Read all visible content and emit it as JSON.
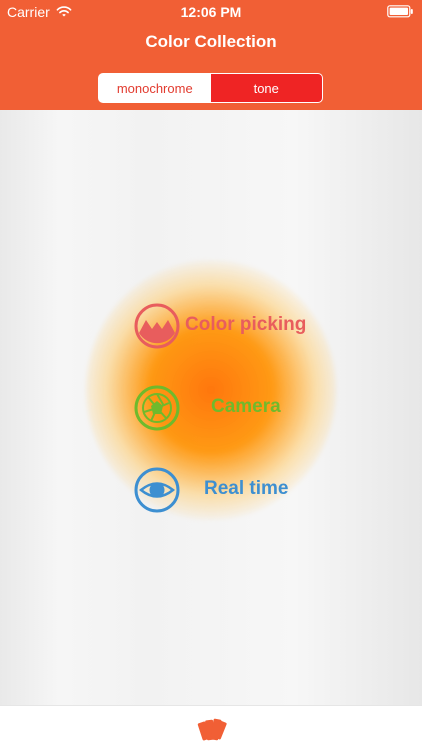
{
  "status_bar": {
    "carrier": "Carrier",
    "time": "12:06 PM",
    "battery_icon": "battery-icon",
    "wifi_icon": "wifi-icon"
  },
  "header": {
    "title": "Color Collection",
    "tabs": [
      {
        "label": "monochrome"
      },
      {
        "label": "tone"
      }
    ]
  },
  "menu": {
    "items": [
      {
        "label": "Color picking",
        "icon": "mountain-icon",
        "color": "#e85d5d"
      },
      {
        "label": "Camera",
        "icon": "camera-shutter-icon",
        "color": "#6fba2c"
      },
      {
        "label": "Real time",
        "icon": "eye-icon",
        "color": "#3d8fd1"
      }
    ]
  },
  "tabbar": {
    "icon": "palette-cards-icon",
    "accent_color": "#f15f35"
  },
  "colors": {
    "header": "#f15f35",
    "segment_active": "#ef2424",
    "segment_inactive_text": "#e23b2f"
  }
}
